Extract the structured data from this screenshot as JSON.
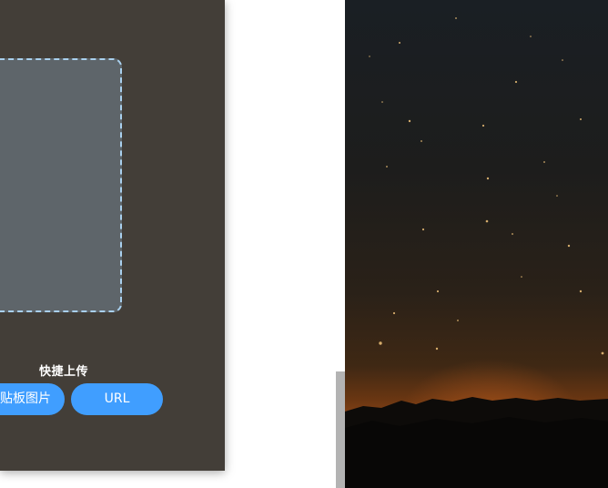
{
  "upload_panel": {
    "quick_upload_label": "快捷上传",
    "clipboard_button_label": "粘贴板图片",
    "url_button_label": "URL"
  },
  "photo": {
    "subject": "starry-night-sky-over-mountain-silhouette"
  },
  "colors": {
    "panel_bg": "#433e38",
    "drop_zone_bg": "#5e656a",
    "drop_zone_border": "#a9d0ee",
    "button_bg": "#409eff"
  }
}
